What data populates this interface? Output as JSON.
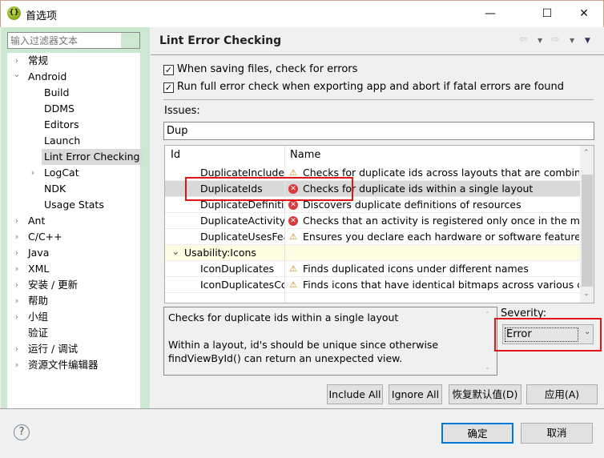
{
  "window": {
    "title": "首选项",
    "minimize": "—",
    "maximize": "☐",
    "close": "✕"
  },
  "sidebar": {
    "filter_placeholder": "输入过滤器文本",
    "items": [
      {
        "label": "常规",
        "level": 0,
        "expander": "collapsed"
      },
      {
        "label": "Android",
        "level": 0,
        "expander": "expanded"
      },
      {
        "label": "Build",
        "level": 1,
        "expander": "none"
      },
      {
        "label": "DDMS",
        "level": 1,
        "expander": "none"
      },
      {
        "label": "Editors",
        "level": 1,
        "expander": "none"
      },
      {
        "label": "Launch",
        "level": 1,
        "expander": "none"
      },
      {
        "label": "Lint Error Checking",
        "level": 1,
        "expander": "none",
        "selected": true
      },
      {
        "label": "LogCat",
        "level": 1,
        "expander": "collapsed"
      },
      {
        "label": "NDK",
        "level": 1,
        "expander": "none"
      },
      {
        "label": "Usage Stats",
        "level": 1,
        "expander": "none"
      },
      {
        "label": "Ant",
        "level": 0,
        "expander": "collapsed"
      },
      {
        "label": "C/C++",
        "level": 0,
        "expander": "collapsed"
      },
      {
        "label": "Java",
        "level": 0,
        "expander": "collapsed"
      },
      {
        "label": "XML",
        "level": 0,
        "expander": "collapsed"
      },
      {
        "label": "安装 / 更新",
        "level": 0,
        "expander": "collapsed"
      },
      {
        "label": "帮助",
        "level": 0,
        "expander": "collapsed"
      },
      {
        "label": "小组",
        "level": 0,
        "expander": "collapsed"
      },
      {
        "label": "验证",
        "level": 0,
        "expander": "none"
      },
      {
        "label": "运行 / 调试",
        "level": 0,
        "expander": "collapsed"
      },
      {
        "label": "资源文件编辑器",
        "level": 0,
        "expander": "collapsed"
      }
    ]
  },
  "page": {
    "title": "Lint Error Checking",
    "check_on_save": {
      "label": "When saving files, check for errors",
      "checked": true
    },
    "check_on_export": {
      "label": "Run full error check when exporting app and abort if fatal errors are found",
      "checked": true
    },
    "issues_label": "Issues:",
    "search_value": "Dup",
    "table": {
      "columns": [
        "Id",
        "Name"
      ],
      "rows": [
        {
          "id": "DuplicateIncludedIds",
          "name": "Checks for duplicate ids across layouts that are combine...",
          "severity": "warning"
        },
        {
          "id": "DuplicateIds",
          "name": "Checks for duplicate ids within a single layout",
          "severity": "error",
          "selected": true
        },
        {
          "id": "DuplicateDefinition",
          "name": "Discovers duplicate definitions of resources",
          "severity": "error"
        },
        {
          "id": "DuplicateActivity",
          "name": "Checks that an activity is registered only once in the mani...",
          "severity": "error"
        },
        {
          "id": "DuplicateUsesFeature",
          "name": "Ensures you declare each hardware or software feature ...",
          "severity": "warning"
        },
        {
          "category": "Usability:Icons"
        },
        {
          "id": "IconDuplicates",
          "name": "Finds duplicated icons under different names",
          "severity": "warning"
        },
        {
          "id": "IconDuplicatesConfig",
          "name": "Finds icons that have identical bitmaps across various co...",
          "severity": "warning"
        }
      ]
    },
    "description": "Checks for duplicate ids within a single layout\n\nWithin a layout, id's should be unique since otherwise\nfindViewById() can return an unexpected view.",
    "severity_label": "Severity:",
    "severity_value": "Error",
    "buttons": {
      "include_all": "Include All",
      "ignore_all": "Ignore All",
      "restore_defaults": "恢复默认值(D)",
      "apply": "应用(A)"
    }
  },
  "footer": {
    "help": "?",
    "ok": "确定",
    "cancel": "取消"
  },
  "colors": {
    "highlight": "#e01515",
    "selection": "#d9d9d9",
    "sidebar_bg": "#cde8d0",
    "default_button": "#0078d7"
  }
}
